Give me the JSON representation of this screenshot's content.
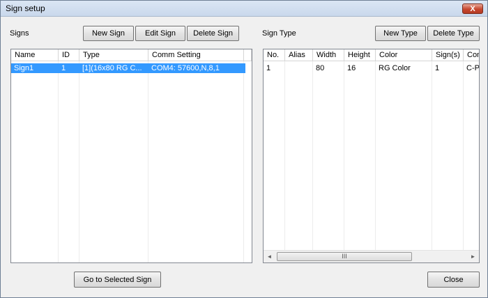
{
  "window": {
    "title": "Sign setup",
    "close_glyph": "X"
  },
  "signs": {
    "label": "Signs",
    "buttons": {
      "new": "New Sign",
      "edit": "Edit Sign",
      "delete": "Delete Sign"
    },
    "columns": [
      "Name",
      "ID",
      "Type",
      "Comm Setting"
    ],
    "rows": [
      {
        "name": "Sign1",
        "id": "1",
        "type": "[1](16x80 RG C...",
        "comm": "COM4: 57600,N,8,1",
        "selected": true
      }
    ]
  },
  "sign_type": {
    "label": "Sign Type",
    "buttons": {
      "new": "New Type",
      "delete": "Delete Type"
    },
    "columns": [
      "No.",
      "Alias",
      "Width",
      "Height",
      "Color",
      "Sign(s)",
      "Com"
    ],
    "rows": [
      {
        "no": "1",
        "alias": "",
        "width": "80",
        "height": "16",
        "color": "RG Color",
        "signs": "1",
        "com": "C-P"
      }
    ],
    "scroll_left": "◄",
    "scroll_right": "►",
    "scroll_thumb": "III"
  },
  "footer": {
    "go_to_selected": "Go to Selected Sign",
    "close": "Close"
  },
  "colors": {
    "selection": "#3399ff",
    "title_bar": "#c9d8ec",
    "close_button": "#c7472f"
  }
}
